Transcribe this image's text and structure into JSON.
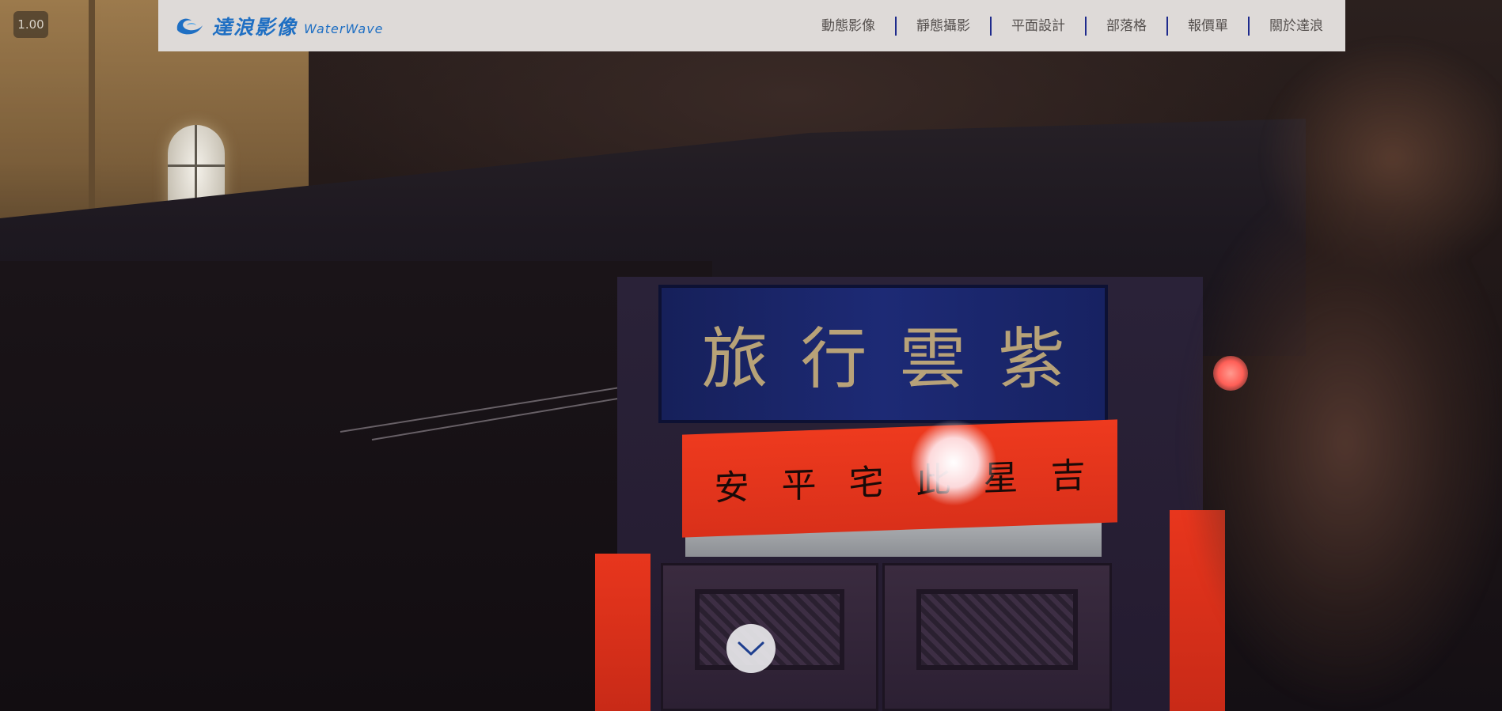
{
  "playback": {
    "speed": "1.00"
  },
  "brand": {
    "name_zh": "達浪影像",
    "name_en": "WaterWave",
    "logo_icon": "wave-swirl-icon",
    "color": "#1f6fc3"
  },
  "nav": {
    "items": [
      {
        "label": "動態影像"
      },
      {
        "label": "靜態攝影"
      },
      {
        "label": "平面設計"
      },
      {
        "label": "部落格"
      },
      {
        "label": "報價單"
      },
      {
        "label": "關於達浪"
      }
    ],
    "separator_color": "#1e2a8c",
    "text_color": "#55504e",
    "background": "#dedad8"
  },
  "scroll_down": {
    "icon": "chevron-down-icon"
  }
}
